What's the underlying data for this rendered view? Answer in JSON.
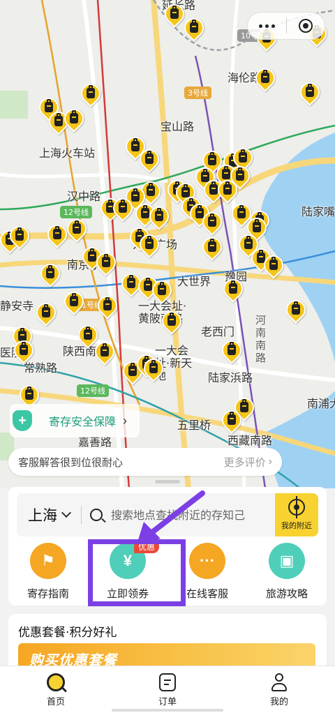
{
  "map": {
    "places": [
      {
        "label": "延长路",
        "cls": ""
      },
      {
        "label": "海伦路",
        "cls": ""
      },
      {
        "label": "宝山路",
        "cls": ""
      },
      {
        "label": "上海火车站",
        "cls": ""
      },
      {
        "label": "汉中路",
        "cls": ""
      },
      {
        "label": "陆家嘴",
        "cls": ""
      },
      {
        "label": "南京东路",
        "cls": ""
      },
      {
        "label": "人民广场",
        "cls": ""
      },
      {
        "label": "大世界",
        "cls": ""
      },
      {
        "label": "豫园",
        "cls": ""
      },
      {
        "label": "静安寺",
        "cls": ""
      },
      {
        "label": "一大会址·黄陂南路",
        "cls": ""
      },
      {
        "label": "老西门",
        "cls": ""
      },
      {
        "label": "陕西南路",
        "cls": ""
      },
      {
        "label": "常熟路",
        "cls": ""
      },
      {
        "label": "一大会址·新天地",
        "cls": ""
      },
      {
        "label": "陆家浜路",
        "cls": ""
      },
      {
        "label": "河南南路",
        "cls": "road"
      },
      {
        "label": "南浦大",
        "cls": ""
      },
      {
        "label": "五里桥",
        "cls": ""
      },
      {
        "label": "西藏南路",
        "cls": ""
      },
      {
        "label": "嘉善路",
        "cls": ""
      },
      {
        "label": "医院",
        "cls": ""
      }
    ],
    "line_badges": [
      {
        "label": "10号线",
        "cls": "gray"
      },
      {
        "label": "3号线",
        "cls": "orange"
      },
      {
        "label": "12号线",
        "cls": ""
      },
      {
        "label": "1号线",
        "cls": "orange"
      },
      {
        "label": "12号线",
        "cls": ""
      }
    ],
    "pin_count": 60
  },
  "security_banner": {
    "label": "寄存安全保障",
    "icon": "shield-plus-icon"
  },
  "review": {
    "message": "客服解答很到位很耐心",
    "more": "更多评价",
    "arrow": "›"
  },
  "search": {
    "city": "上海",
    "placeholder": "搜索地点查找附近的存知己",
    "nearby_label": "我的附近"
  },
  "quick_actions": [
    {
      "label": "寄存指南",
      "icon": "guide-signpost-icon",
      "color": "#f5a623",
      "glyph": "⚑"
    },
    {
      "label": "立即领券",
      "icon": "coupon-ticket-icon",
      "color": "#4fcfb9",
      "glyph": "¥",
      "badge": "优惠"
    },
    {
      "label": "在线客服",
      "icon": "chat-bubble-icon",
      "color": "#f5a623",
      "glyph": "···"
    },
    {
      "label": "旅游攻略",
      "icon": "travel-book-icon",
      "color": "#4fcfb9",
      "glyph": "▣"
    }
  ],
  "promo": {
    "title": "优惠套餐·积分好礼",
    "banner_text": "购买优惠套餐"
  },
  "tabs": [
    {
      "label": "首页",
      "icon": "home-search-icon"
    },
    {
      "label": "订单",
      "icon": "order-list-icon"
    },
    {
      "label": "我的",
      "icon": "profile-icon"
    }
  ],
  "colors": {
    "brand_yellow": "#f8d230",
    "teal": "#4fcfb9",
    "annotation_purple": "#7b3fe4"
  }
}
